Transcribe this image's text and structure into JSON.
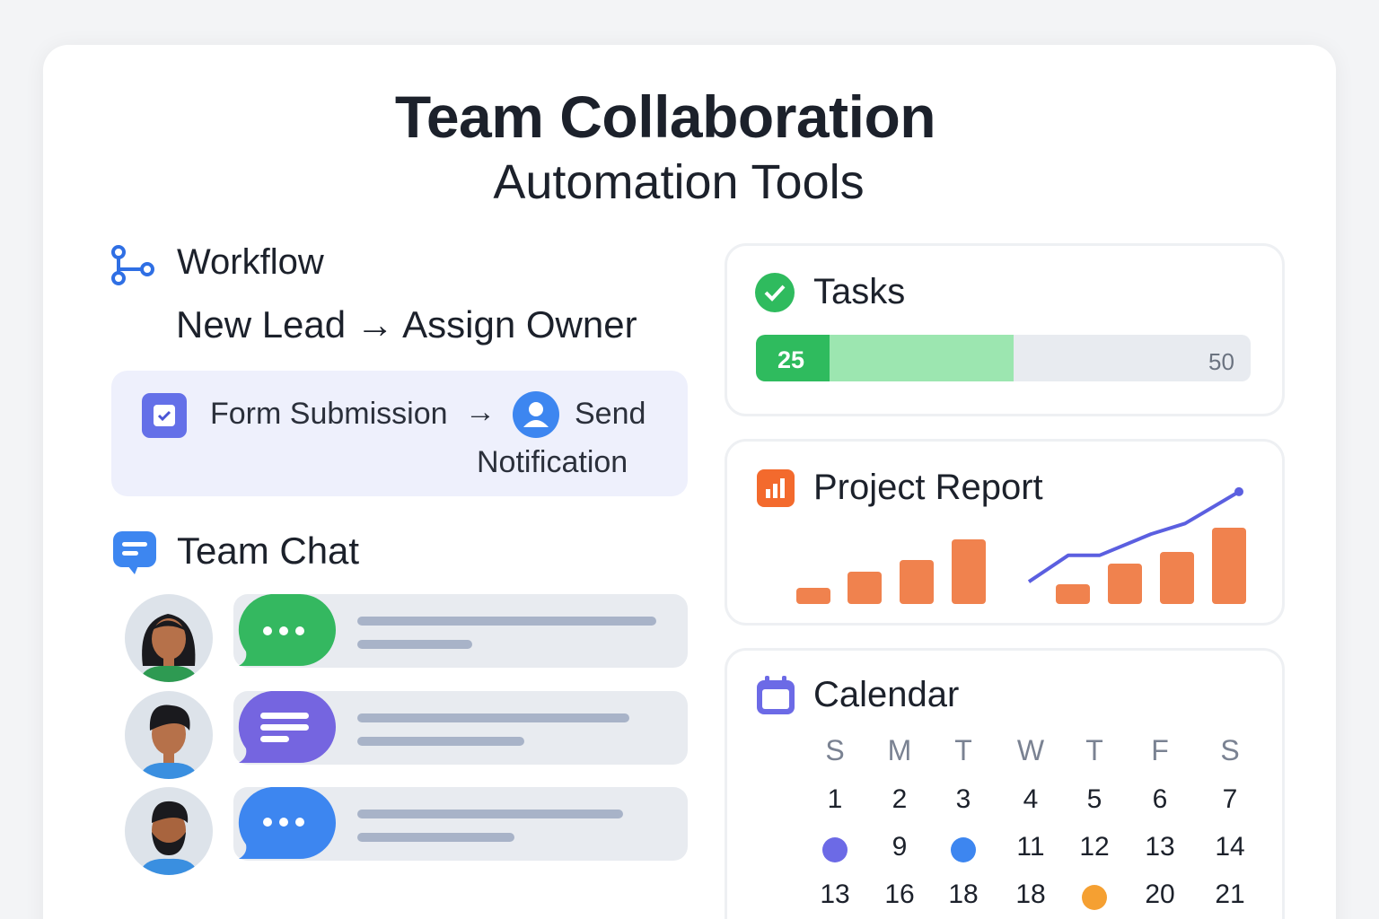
{
  "title": "Team Collaboration",
  "subtitle": "Automation Tools",
  "workflow": {
    "title": "Workflow",
    "rule": "New Lead → Assign Owner",
    "trigger": "Form Submission",
    "arrow": "→",
    "action_line1": "Send",
    "action_line2": "Notification",
    "icon": "workflow-icon"
  },
  "team_chat": {
    "title": "Team Chat",
    "messages": [
      {
        "bubble": "typing-dots",
        "color": "#34b860",
        "avatar": "woman-avatar"
      },
      {
        "bubble": "text-lines",
        "color": "#7565e0",
        "avatar": "man-avatar"
      },
      {
        "bubble": "typing-dots",
        "color": "#3d86f0",
        "avatar": "bearded-man-avatar"
      }
    ]
  },
  "tasks": {
    "title": "Tasks",
    "done": "25",
    "total": "50",
    "progress_fraction": 0.52,
    "accent": "#2fbb5e"
  },
  "project_report": {
    "title": "Project Report",
    "accent": "#f0824e",
    "line_color": "#5b5fe0"
  },
  "chart_data": {
    "type": "bar",
    "title": "",
    "categories": [
      "",
      "",
      "",
      "",
      "",
      "",
      "",
      ""
    ],
    "values": [
      2,
      4,
      5.5,
      8,
      2.5,
      5,
      6.5,
      9.5
    ],
    "line": [
      1,
      3.5,
      3.5,
      5.5,
      6.5,
      9.5
    ],
    "ylim": [
      0,
      10
    ],
    "grid": false
  },
  "calendar": {
    "title": "Calendar",
    "weekdays": [
      "S",
      "M",
      "T",
      "W",
      "T",
      "F",
      "S"
    ],
    "rows": [
      [
        "1",
        "2",
        "3",
        "4",
        "5",
        "6",
        "7"
      ],
      [
        "",
        "9",
        "",
        "11",
        "12",
        "13",
        "14"
      ],
      [
        "13",
        "16",
        "18",
        "18",
        "",
        "20",
        "21"
      ]
    ],
    "event_dots": [
      {
        "row": 1,
        "col": 0,
        "color": "#6c6ae6"
      },
      {
        "row": 1,
        "col": 2,
        "color": "#3d86f0"
      },
      {
        "row": 2,
        "col": 4,
        "color": "#f5a032"
      }
    ]
  }
}
